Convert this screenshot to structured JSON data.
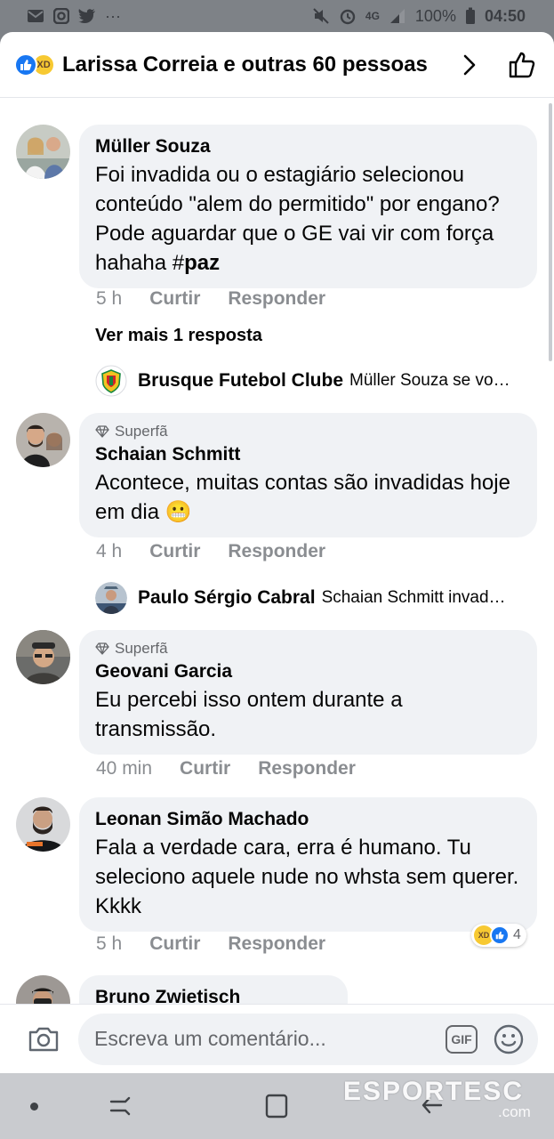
{
  "status_bar": {
    "network": "4G",
    "battery": "100%",
    "time": "04:50",
    "more": "···"
  },
  "header": {
    "title": "Larissa Correia e outras 60 pessoas",
    "haha_emoji": "XD"
  },
  "comments": [
    {
      "author": "Müller Souza",
      "text": "Foi invadida ou o estagiário selecionou conteúdo \"alem do permitido\" por engano? Pode aguardar que o GE vai vir com força hahaha #",
      "hashtag": "paz",
      "time": "5 h",
      "like": "Curtir",
      "reply": "Responder",
      "more_replies": "Ver mais 1 resposta",
      "reply_preview": {
        "name": "Brusque Futebol Clube",
        "text": "Müller Souza se vo…"
      }
    },
    {
      "badge": "Superfã",
      "author": "Schaian Schmitt",
      "text": "Acontece, muitas contas são invadidas hoje em dia 😬",
      "time": "4 h",
      "like": "Curtir",
      "reply": "Responder",
      "reply_preview": {
        "name": "Paulo Sérgio Cabral",
        "text": "Schaian Schmitt invad…"
      }
    },
    {
      "badge": "Superfã",
      "author": "Geovani Garcia",
      "text": "Eu percebi isso ontem durante a transmissão.",
      "time": "40 min",
      "like": "Curtir",
      "reply": "Responder"
    },
    {
      "author": "Leonan Simão Machado",
      "text": "Fala a verdade cara, erra é humano. Tu seleciono aquele nude no whsta sem querer. Kkkk",
      "time": "5 h",
      "like": "Curtir",
      "reply": "Responder",
      "reaction_count": "4"
    },
    {
      "author": "Bruno Zwietisch"
    }
  ],
  "composer": {
    "placeholder": "Escreva um comentário...",
    "gif": "GIF"
  },
  "watermark": {
    "brand": "ESPORTESC",
    "domain": ".com"
  },
  "colors": {
    "accent": "#1877f2",
    "bubble": "#f0f2f5",
    "muted": "#8a8d91"
  },
  "icons": [
    "mail-icon",
    "instagram-icon",
    "twitter-icon",
    "mute-icon",
    "alarm-icon",
    "signal-icon",
    "chevron-right-icon",
    "like-outline-icon",
    "camera-icon",
    "gif-icon",
    "emoji-icon"
  ]
}
